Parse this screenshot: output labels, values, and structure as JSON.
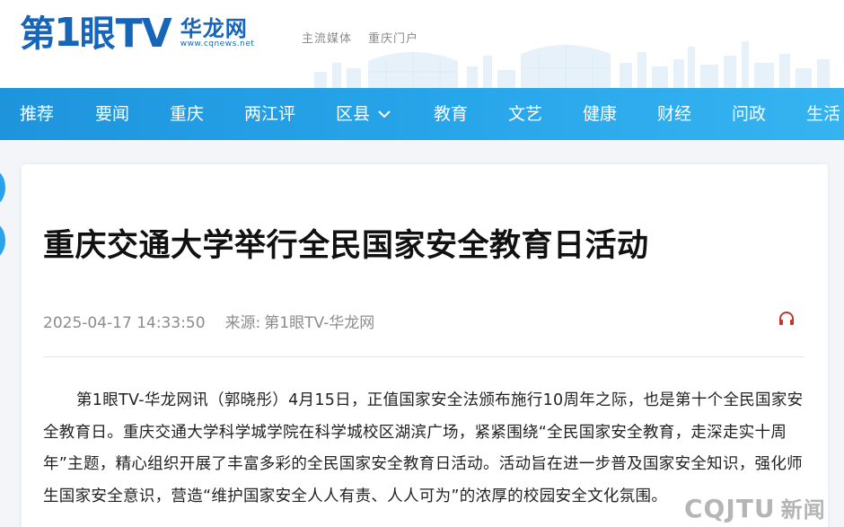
{
  "header": {
    "logo_main_prefix": "第",
    "logo_main_one": "1",
    "logo_main_suffix": "眼",
    "logo_tv": "TV",
    "logo_hualong": "华龙网",
    "logo_url": "www.cqnews.net",
    "slogan_1": "主流媒体",
    "slogan_2": "重庆门户"
  },
  "nav": {
    "items": [
      {
        "label": "推荐"
      },
      {
        "label": "要闻"
      },
      {
        "label": "重庆"
      },
      {
        "label": "两江评"
      },
      {
        "label": "区县"
      },
      {
        "label": "教育"
      },
      {
        "label": "文艺"
      },
      {
        "label": "健康"
      },
      {
        "label": "财经"
      },
      {
        "label": "问政"
      },
      {
        "label": "生活"
      }
    ]
  },
  "article": {
    "title": "重庆交通大学举行全民国家安全教育日活动",
    "datetime": "2025-04-17 14:33:50",
    "source_label": "来源:",
    "source_value": "第1眼TV-华龙网",
    "body": "第1眼TV-华龙网讯（郭晓彤）4月15日，正值国家安全法颁布施行10周年之际，也是第十个全民国家安全教育日。重庆交通大学科学城学院在科学城校区湖滨广场，紧紧围绕“全民国家安全教育，走深走实十周年”主题，精心组织开展了丰富多彩的全民国家安全教育日活动。活动旨在进一步普及国家安全知识，强化师生国家安全意识，营造“维护国家安全人人有责、人人可为”的浓厚的校园安全文化氛围。"
  },
  "watermark": {
    "latin": "CQJTU",
    "chinese": "新闻"
  },
  "colors": {
    "brand_blue": "#1565b8",
    "nav_blue": "#28a6ea",
    "listen_icon_red": "#c0392b"
  },
  "icons": {
    "nav_dropdown": "chevron-down-icon",
    "listen": "headphones-icon"
  }
}
